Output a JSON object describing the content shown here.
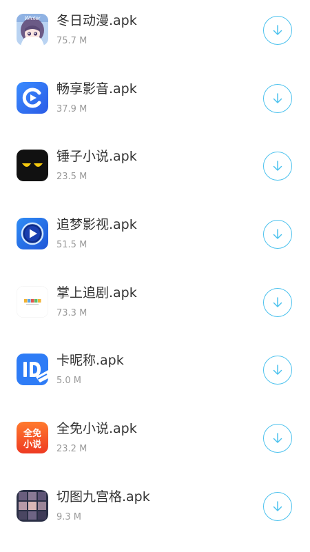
{
  "apps": [
    {
      "name": "冬日动漫.apk",
      "size": "75.7 M",
      "icon": "anime-girl-icon",
      "icon_badge": "Winter"
    },
    {
      "name": "畅享影音.apk",
      "size": "37.9 M",
      "icon": "play-circle-icon"
    },
    {
      "name": "锤子小说.apk",
      "size": "23.5 M",
      "icon": "cat-eyes-icon"
    },
    {
      "name": "追梦影视.apk",
      "size": "51.5 M",
      "icon": "play-disc-icon"
    },
    {
      "name": "掌上追剧.apk",
      "size": "73.3 M",
      "icon": "colored-blocks-icon"
    },
    {
      "name": "卡昵称.apk",
      "size": "5.0 M",
      "icon": "id-card-icon"
    },
    {
      "name": "全免小说.apk",
      "size": "23.2 M",
      "icon": "free-novel-icon",
      "icon_text": [
        "全免",
        "小说"
      ]
    },
    {
      "name": "切图九宫格.apk",
      "size": "9.3 M",
      "icon": "grid-nine-icon"
    }
  ],
  "colors": {
    "download_accent": "#4cc2ee",
    "name_text": "#333333",
    "size_text": "#9a9a9a"
  }
}
